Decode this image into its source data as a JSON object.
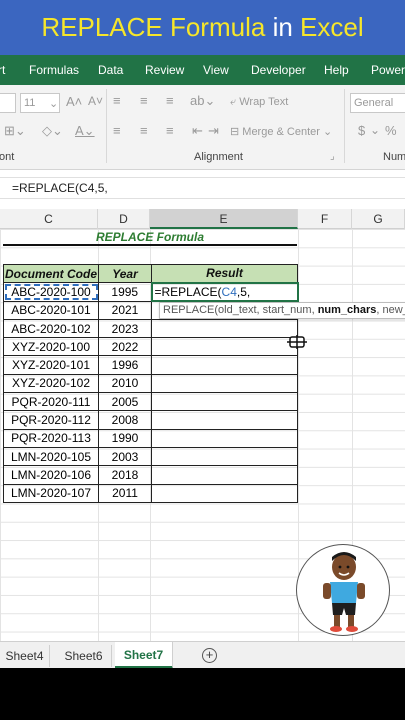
{
  "banner": {
    "title_part1": "REPLACE Formula",
    "title_part2": "in",
    "title_part3": "Excel"
  },
  "ribbon": {
    "tabs": [
      "rt",
      "Formulas",
      "Data",
      "Review",
      "View",
      "Developer",
      "Help",
      "Power"
    ],
    "font_size": "11",
    "wrap_text": "Wrap Text",
    "merge_center": "Merge & Center",
    "number_format": "General",
    "currency": "$",
    "percent": "%",
    "group_font": "ont",
    "group_alignment": "Alignment",
    "group_number": "Num"
  },
  "formula_bar": {
    "value": "=REPLACE(C4,5,"
  },
  "columns": [
    "C",
    "D",
    "E",
    "F",
    "G"
  ],
  "table": {
    "title": "REPLACE Formula",
    "headers": [
      "Document Code",
      "Year",
      "Result"
    ],
    "rows": [
      [
        "ABC-2020-100",
        "1995"
      ],
      [
        "ABC-2020-101",
        "2021"
      ],
      [
        "ABC-2020-102",
        "2023"
      ],
      [
        "XYZ-2020-100",
        "2022"
      ],
      [
        "XYZ-2020-101",
        "1996"
      ],
      [
        "XYZ-2020-102",
        "2010"
      ],
      [
        "PQR-2020-111",
        "2005"
      ],
      [
        "PQR-2020-112",
        "2008"
      ],
      [
        "PQR-2020-113",
        "1990"
      ],
      [
        "LMN-2020-105",
        "2003"
      ],
      [
        "LMN-2020-106",
        "2018"
      ],
      [
        "LMN-2020-107",
        "2011"
      ]
    ],
    "editing_cell": {
      "prefix": "=REPLACE(",
      "ref": "C4",
      "suffix": ",5,"
    }
  },
  "tooltip": {
    "start": "REPLACE(old_text, start_num, ",
    "bold": "num_chars",
    "end": ", new_tex"
  },
  "sheets": [
    "Sheet4",
    "Sheet6",
    "Sheet7"
  ],
  "active_sheet": "Sheet7",
  "colors": {
    "excel_green": "#217346",
    "banner_blue": "#3b66c0",
    "title_yellow": "#f6e62a",
    "header_fill": "#c6e0b4"
  }
}
